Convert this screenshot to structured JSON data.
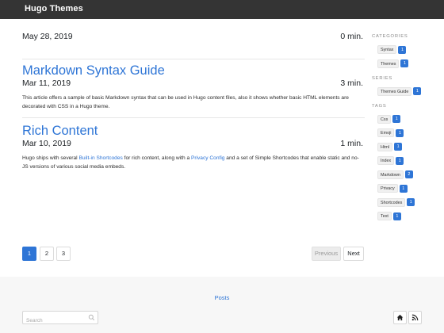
{
  "site": {
    "brand": "Hugo Themes"
  },
  "posts": [
    {
      "title": "",
      "date": "May 28, 2019",
      "read_time": "0 min.",
      "summary": ""
    },
    {
      "title": "Markdown Syntax Guide",
      "date": "Mar 11, 2019",
      "read_time": "3 min.",
      "summary": "This article offers a sample of basic Markdown syntax that can be used in Hugo content files, also it shows whether basic HTML elements are decorated with CSS in a Hugo theme."
    },
    {
      "title": "Rich Content",
      "date": "Mar 10, 2019",
      "read_time": "1 min.",
      "summary_parts": [
        "Hugo ships with several ",
        "Built-in Shortcodes",
        " for rich content, along with a ",
        "Privacy Config",
        " and a set of Simple Shortcodes that enable static and no-JS versions of various social media embeds."
      ]
    }
  ],
  "pagination": {
    "pages": [
      "1",
      "2",
      "3"
    ],
    "active": "1",
    "previous": "Previous",
    "next": "Next"
  },
  "sidebar": {
    "categories": {
      "heading": "CATEGORIES",
      "items": [
        {
          "label": "Syntax",
          "count": "1"
        },
        {
          "label": "Themes",
          "count": "1"
        }
      ]
    },
    "series": {
      "heading": "SERIES",
      "items": [
        {
          "label": "Themes Guide",
          "count": "1"
        }
      ]
    },
    "tags": {
      "heading": "TAGS",
      "items": [
        {
          "label": "Css",
          "count": "1"
        },
        {
          "label": "Emoji",
          "count": "1"
        },
        {
          "label": "Html",
          "count": "1"
        },
        {
          "label": "Index",
          "count": "1"
        },
        {
          "label": "Markdown",
          "count": "2"
        },
        {
          "label": "Privacy",
          "count": "1"
        },
        {
          "label": "Shortcodes",
          "count": "1"
        },
        {
          "label": "Text",
          "count": "1"
        }
      ]
    }
  },
  "footer": {
    "link": "Posts",
    "search": {
      "placeholder": "Search",
      "value": ""
    },
    "icons": [
      "home-icon",
      "rss-icon"
    ]
  },
  "colors": {
    "accent": "#2e75d6",
    "topbar": "#343434",
    "footer_bg": "#f7f7f7"
  }
}
